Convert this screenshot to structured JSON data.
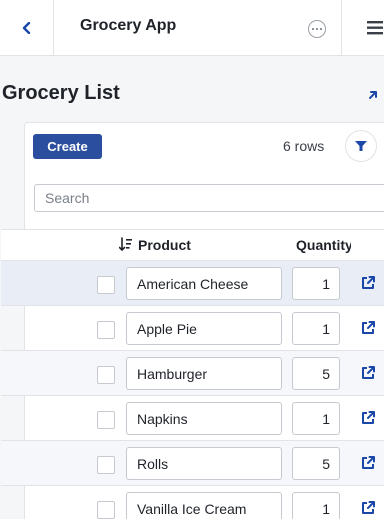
{
  "header": {
    "title": "Grocery App",
    "back_icon": "chevron-left-icon",
    "more_icon": "more-horizontal-icon",
    "menu_icon": "menu-icon"
  },
  "section": {
    "title": "Grocery List",
    "expand_icon": "arrow-up-right-icon"
  },
  "toolbar": {
    "create_label": "Create",
    "row_count": "6 rows",
    "filter_icon": "filter-icon"
  },
  "search": {
    "placeholder": "Search",
    "value": ""
  },
  "table": {
    "columns": {
      "product": "Product",
      "quantity": "Quantity"
    },
    "sort_icon": "sort-descending-icon",
    "rows": [
      {
        "product": "American Cheese",
        "quantity": "1"
      },
      {
        "product": "Apple Pie",
        "quantity": "1"
      },
      {
        "product": "Hamburger",
        "quantity": "5"
      },
      {
        "product": "Napkins",
        "quantity": "1"
      },
      {
        "product": "Rolls",
        "quantity": "5"
      },
      {
        "product": "Vanilla Ice Cream",
        "quantity": "1"
      }
    ],
    "open_icon": "open-external-icon"
  },
  "colors": {
    "accent": "#2b4f9e",
    "icon_blue": "#1a47a8",
    "selected_row": "#e8edf6"
  }
}
